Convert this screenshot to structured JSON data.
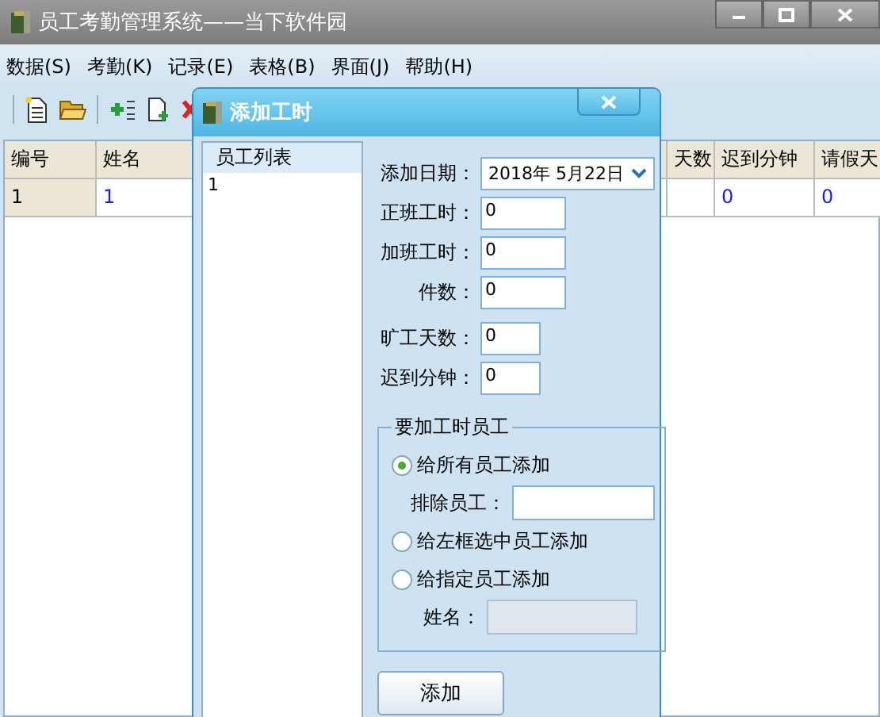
{
  "window": {
    "title": "员工考勤管理系统——当下软件园"
  },
  "menu": [
    {
      "label": "数据(S)"
    },
    {
      "label": "考勤(K)"
    },
    {
      "label": "记录(E)"
    },
    {
      "label": "表格(B)"
    },
    {
      "label": "界面(J)"
    },
    {
      "label": "帮助(H)"
    }
  ],
  "table": {
    "columns": [
      {
        "label": "编号",
        "kind": "key"
      },
      {
        "label": "姓名",
        "kind": "name"
      },
      {
        "label": "天数",
        "kind": "partial"
      },
      {
        "label": "迟到分钟",
        "kind": "value"
      },
      {
        "label": "请假天",
        "kind": "edge"
      }
    ],
    "rows": [
      {
        "cells": [
          "1",
          "1",
          null,
          "0",
          "0"
        ]
      }
    ]
  },
  "dialog": {
    "title": "添加工时",
    "employee_list": {
      "header": "员工列表",
      "items": [
        "1"
      ]
    },
    "fields": [
      {
        "label": "添加日期：",
        "kind": "date",
        "value": "2018年  5月22日"
      },
      {
        "label": "正班工时：",
        "kind": "wide",
        "value": "0"
      },
      {
        "label": "加班工时：",
        "kind": "wide",
        "value": "0"
      },
      {
        "label": "件数：",
        "kind": "wide",
        "value": "0"
      },
      {
        "label": "旷工天数：",
        "kind": "narrow",
        "value": "0"
      },
      {
        "label": "迟到分钟：",
        "kind": "narrow",
        "value": "0"
      }
    ],
    "group": {
      "title": "要加工时员工",
      "options": [
        {
          "label": "给所有员工添加",
          "selected": true,
          "sub": {
            "label": "排除员工：",
            "disabled": false
          }
        },
        {
          "label": "给左框选中员工添加",
          "selected": false
        },
        {
          "label": "给指定员工添加",
          "selected": false,
          "sub": {
            "label": "姓名：",
            "disabled": true
          }
        }
      ]
    },
    "button": "添加"
  }
}
